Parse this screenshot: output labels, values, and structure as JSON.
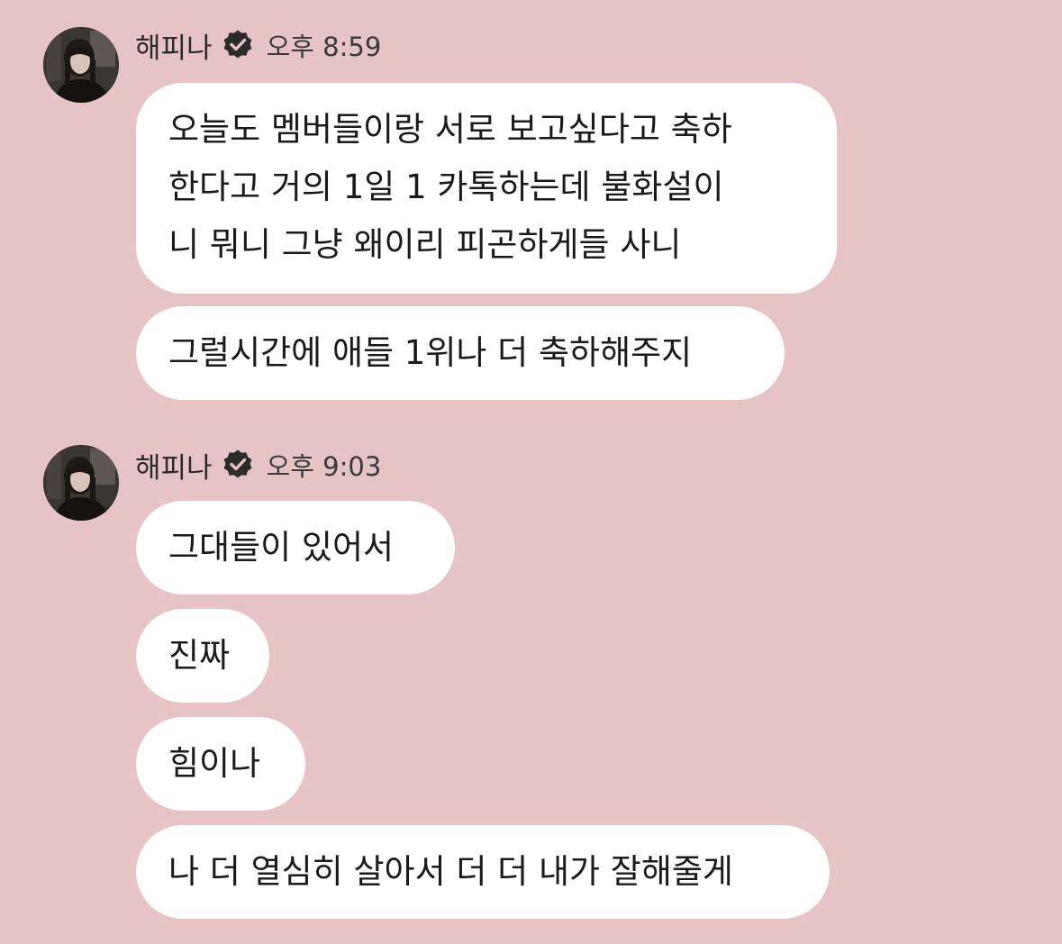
{
  "groups": [
    {
      "sender": "해피나",
      "verified_icon": "verified-check-icon",
      "time": "오후 8:59",
      "messages": [
        {
          "lines": [
            "오늘도 멤버들이랑 서로 보고싶다고 축하",
            "한다고 거의 1일 1 카톡하는데 불화설이",
            "니 뭐니 그냥 왜이리 피곤하게들 사니"
          ]
        },
        {
          "text": "그럴시간에 애들 1위나 더 축하해주지"
        }
      ]
    },
    {
      "sender": "해피나",
      "verified_icon": "verified-check-icon",
      "time": "오후 9:03",
      "messages": [
        {
          "text": "그대들이 있어서"
        },
        {
          "text": "진짜"
        },
        {
          "text": "힘이나"
        },
        {
          "text": "나 더 열심히 살아서 더 더 내가 잘해줄게"
        }
      ]
    }
  ],
  "colors": {
    "background": "#e6c3c4",
    "bubble": "#ffffff",
    "text": "#1a1a1a",
    "verified_badge": "#2b2b2b"
  }
}
